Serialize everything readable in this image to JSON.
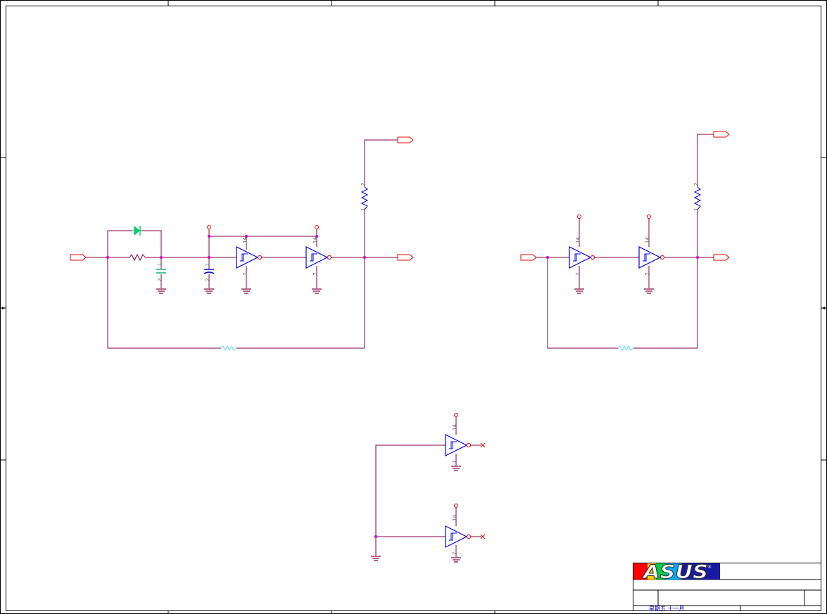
{
  "title_block": {
    "logo_text": "ASUS",
    "registered_mark": "®",
    "footer_text": "星期五 十一月"
  },
  "pin_numbers": {
    "vcc": "14",
    "gnd": "7",
    "pin_one": "1",
    "pin_two": "2"
  },
  "colors": {
    "wire": "#800040",
    "border": "#000000",
    "connector": "#ff0000",
    "junction": "#cc00cc",
    "gate": "#0000ff",
    "diode": "#00cc66",
    "capacitor_green": "#00aa66",
    "capacitor_blue": "#0000cc",
    "hidden_resistor": "#66ddff",
    "title_text": "#0000cc"
  },
  "icons": {
    "input_port": "offpage-connector-icon",
    "output_port": "offpage-connector-icon",
    "inverter": "schmitt-inverter-icon",
    "ground": "ground-icon",
    "resistor": "resistor-icon",
    "capacitor": "capacitor-icon",
    "diode": "diode-icon",
    "no_connect": "no-connect-icon"
  }
}
